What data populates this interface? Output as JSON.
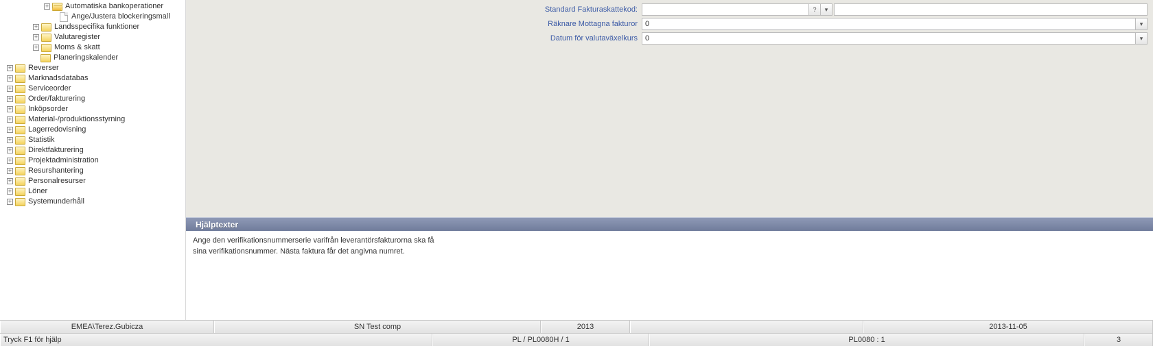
{
  "tree": {
    "deep": [
      {
        "label": "Automatiska bankoperationer",
        "exp": "+",
        "icon": "folder-open",
        "indent": 60
      },
      {
        "label": "Ange/Justera blockeringsmall",
        "exp": "",
        "icon": "file",
        "indent": 72
      }
    ],
    "sub": [
      {
        "label": "Landsspecifika funktioner",
        "exp": "+",
        "icon": "folder",
        "indent": 44
      },
      {
        "label": "Valutaregister",
        "exp": "+",
        "icon": "folder",
        "indent": 44
      },
      {
        "label": "Moms & skatt",
        "exp": "+",
        "icon": "folder",
        "indent": 44
      },
      {
        "label": "Planeringskalender",
        "exp": "",
        "icon": "folder",
        "indent": 44
      }
    ],
    "top": [
      {
        "label": "Reverser"
      },
      {
        "label": "Marknadsdatabas"
      },
      {
        "label": "Serviceorder"
      },
      {
        "label": "Order/fakturering"
      },
      {
        "label": "Inköpsorder"
      },
      {
        "label": "Material-/produktionsstyrning"
      },
      {
        "label": "Lagerredovisning"
      },
      {
        "label": "Statistik"
      },
      {
        "label": "Direktfakturering"
      },
      {
        "label": "Projektadministration"
      },
      {
        "label": "Resurshantering"
      },
      {
        "label": "Personalresurser"
      },
      {
        "label": "Löner"
      },
      {
        "label": "Systemunderhåll"
      }
    ]
  },
  "form": {
    "rows": [
      {
        "label": "Standard Fakturaskattekod:",
        "value": "",
        "buttons": [
          "lookup",
          "dropdown"
        ],
        "trailing_dropdown": false
      },
      {
        "label": "Räknare Mottagna fakturor",
        "value": "0",
        "buttons": [],
        "trailing_dropdown": true
      },
      {
        "label": "Datum för valutaväxelkurs",
        "value": "0",
        "buttons": [],
        "trailing_dropdown": true
      }
    ]
  },
  "help": {
    "title": "Hjälptexter",
    "line1": "Ange den verifikationsnummerserie varifrån leverantörsfakturorna ska få",
    "line2": "sina verifikationsnummer. Nästa faktura får det angivna numret."
  },
  "status1": {
    "user": "EMEA\\Terez.Gubicza",
    "company": "SN Test comp",
    "year": "2013",
    "blank": "",
    "date": "2013-11-05"
  },
  "status2": {
    "hint": "Tryck F1 för hjälp",
    "prog": "PL / PL0080H / 1",
    "task": "PL0080 : 1",
    "num": "3"
  },
  "glyphs": {
    "plus": "+",
    "lookup": "?",
    "drop": "▾"
  }
}
